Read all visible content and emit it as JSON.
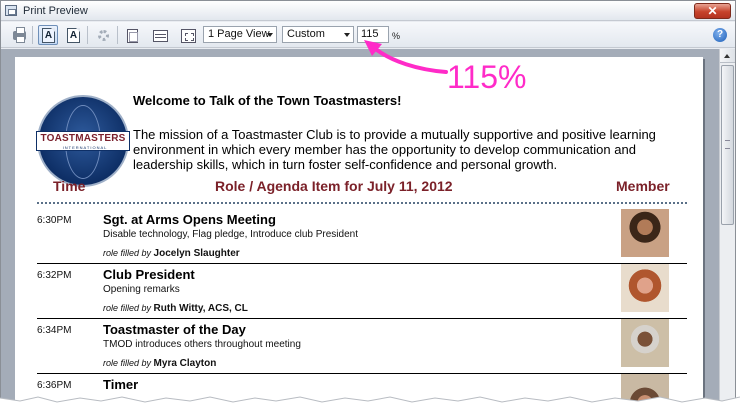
{
  "window": {
    "title": "Print Preview",
    "close_glyph": "✕"
  },
  "toolbar": {
    "view_mode": "1 Page View",
    "zoom_mode": "Custom",
    "zoom_value": "115",
    "zoom_unit": "%",
    "help_glyph": "?"
  },
  "document": {
    "logo": {
      "band": "TOASTMASTERS",
      "sub": "INTERNATIONAL"
    },
    "welcome": "Welcome to Talk of the Town Toastmasters!",
    "mission": "The mission of a Toastmaster Club is to provide a mutually supportive and positive learning environment in which every member has the opportunity to develop communication and leadership skills, which in turn foster self-confidence and personal growth.",
    "headers": {
      "time": "Time",
      "role": "Role / Agenda Item for July 11, 2012",
      "member": "Member"
    },
    "filled_prefix": "role filled by",
    "rows": [
      {
        "time": "6:30PM",
        "role": "Sgt. at Arms Opens Meeting",
        "desc": "Disable technology, Flag pledge, Introduce club President",
        "member": "Jocelyn Slaughter"
      },
      {
        "time": "6:32PM",
        "role": "Club President",
        "desc": "Opening remarks",
        "member": "Ruth Witty, ACS, CL"
      },
      {
        "time": "6:34PM",
        "role": "Toastmaster of the Day",
        "desc": "TMOD introduces others throughout meeting",
        "member": "Myra Clayton"
      },
      {
        "time": "6:36PM",
        "role": "Timer",
        "desc": "",
        "member": ""
      }
    ]
  },
  "annotation": {
    "text": "115%",
    "color": "#ff2bc8"
  }
}
